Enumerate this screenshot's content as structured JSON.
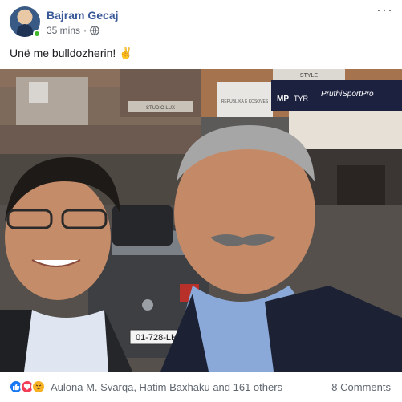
{
  "post": {
    "author": "Bajram Gecaj",
    "time": "35 mins",
    "separator": "·",
    "text": "Unë me bulldozherin! ✌",
    "more_icon": "more-horizontal-icon",
    "privacy_icon": "globe-icon"
  },
  "photo": {
    "signs": {
      "shop_left": "STUDIO LUX",
      "institution": "REPUBLIKA E KOSOVËS",
      "brand1": "MP",
      "brand2": "TYR",
      "sport_shop": "PruthiSportPro",
      "top_sign": "STYLE"
    },
    "plate": "01-728-LH"
  },
  "footer": {
    "reactions_text": "Aulona M. Svarqa, Hatim Baxhaku and 161 others",
    "comments": "8 Comments",
    "reaction_icons": [
      "like-icon",
      "love-icon",
      "haha-icon"
    ]
  },
  "colors": {
    "author_link": "#385898",
    "meta_gray": "#616770",
    "like_blue": "#1877f2",
    "love_red": "#f33e58",
    "haha_yellow": "#f7b125"
  }
}
